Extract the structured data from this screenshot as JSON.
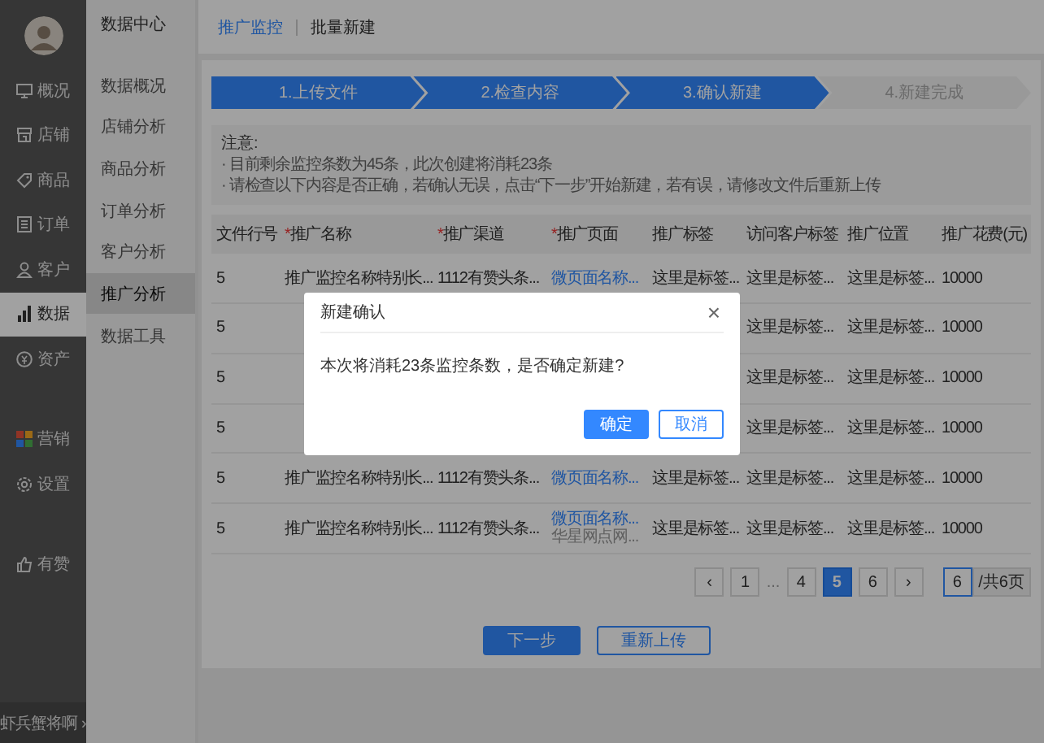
{
  "nav_groups": [
    [
      {
        "label": "概况",
        "selected": false
      },
      {
        "label": "店铺",
        "selected": false
      },
      {
        "label": "商品",
        "selected": false
      },
      {
        "label": "订单",
        "selected": false
      },
      {
        "label": "客户",
        "selected": false
      },
      {
        "label": "数据",
        "selected": true
      },
      {
        "label": "资产",
        "selected": false
      }
    ],
    [
      {
        "label": "营销",
        "selected": false
      },
      {
        "label": "设置",
        "selected": false
      }
    ],
    [
      {
        "label": "有赞",
        "selected": false
      }
    ]
  ],
  "user": {
    "name": "虾兵蟹将啊",
    "arrow": "›"
  },
  "subnav": {
    "title": "数据中心",
    "items": [
      {
        "label": "数据概况",
        "selected": false
      },
      {
        "label": "店铺分析",
        "selected": false
      },
      {
        "label": "商品分析",
        "selected": false
      },
      {
        "label": "订单分析",
        "selected": false
      },
      {
        "label": "客户分析",
        "selected": false
      },
      {
        "label": "推广分析",
        "selected": true
      },
      {
        "label": "数据工具",
        "selected": false
      }
    ]
  },
  "breadcrumb": [
    {
      "label": "推广监控",
      "kind": "link"
    },
    {
      "label": "批量新建",
      "kind": "current"
    }
  ],
  "steps": [
    {
      "label": "1.上传文件",
      "done": true
    },
    {
      "label": "2.检查内容",
      "done": true
    },
    {
      "label": "3.确认新建",
      "done": true
    },
    {
      "label": "4.新建完成",
      "done": false
    }
  ],
  "notice": {
    "title": "注意:",
    "lines": [
      "· 目前剩余监控条数为45条，此次创建将消耗23条",
      "· 请检查以下内容是否正确，若确认无误，点击“下一步”开始新建，若有误，请修改文件后重新上传"
    ]
  },
  "table": {
    "columns": [
      {
        "label": "文件行号"
      },
      {
        "label": "推广名称",
        "mark": "*"
      },
      {
        "label": "推广渠道",
        "mark": "*"
      },
      {
        "label": "推广页面",
        "mark": "*"
      },
      {
        "label": "推广标签"
      },
      {
        "label": "访问客户标签"
      },
      {
        "label": "推广位置"
      },
      {
        "label": "推广花费(元)"
      }
    ],
    "rows": [
      {
        "cells": [
          "5",
          "推广监控名称特别长...",
          "1112有赞头条...",
          "微页面名称...",
          "这里是标签...",
          "这里是标签...",
          "这里是标签...",
          "10000"
        ]
      },
      {
        "cells": [
          "5",
          null,
          null,
          null,
          null,
          "这里是标签...",
          "这里是标签...",
          "10000"
        ]
      },
      {
        "cells": [
          "5",
          null,
          null,
          null,
          null,
          "这里是标签...",
          "这里是标签...",
          "10000"
        ]
      },
      {
        "cells": [
          "5",
          null,
          null,
          null,
          null,
          "这里是标签...",
          "这里是标签...",
          "10000"
        ]
      },
      {
        "cells": [
          "5",
          "推广监控名称特别长...",
          "1112有赞头条...",
          "微页面名称...",
          "这里是标签...",
          "这里是标签...",
          "这里是标签...",
          "10000"
        ]
      },
      {
        "cells": [
          "5",
          "推广监控名称特别长...",
          "1112有赞头条...",
          "微页面名称...",
          "这里是标签...",
          "这里是标签...",
          "这里是标签...",
          "10000"
        ],
        "sub": "华星网点网..."
      }
    ]
  },
  "pagination": {
    "prev": "‹",
    "next": "›",
    "pages": [
      {
        "label": "1",
        "kind": "page",
        "selected": false
      },
      {
        "label": "...",
        "kind": "gap"
      },
      {
        "label": "4",
        "kind": "page",
        "selected": false
      },
      {
        "label": "5",
        "kind": "page",
        "selected": true
      },
      {
        "label": "6",
        "kind": "page",
        "selected": false
      }
    ],
    "jump": "6",
    "total": "/共6页"
  },
  "actions": [
    {
      "label": "下一步",
      "kind": "primary"
    },
    {
      "label": "重新上传",
      "kind": "secondary"
    }
  ],
  "dialog": {
    "title": "新建确认",
    "close": "×",
    "message": "本次将消耗23条监控条数，是否确定新建?",
    "buttons": [
      {
        "label": "确定",
        "kind": "primary"
      },
      {
        "label": "取消",
        "kind": "secondary"
      }
    ]
  }
}
